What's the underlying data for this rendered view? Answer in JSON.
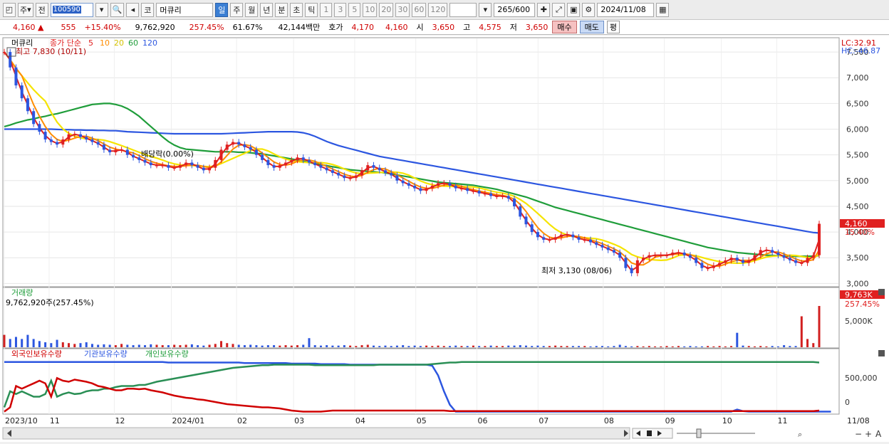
{
  "toolbar": {
    "market_label": "주",
    "prev_label": "전",
    "stock_code": "100590",
    "chart_kind": "코",
    "stock_name": "머큐리",
    "periods": [
      "일",
      "주",
      "월",
      "년",
      "분",
      "초",
      "틱"
    ],
    "active_period": "일",
    "intervals": [
      "1",
      "3",
      "5",
      "10",
      "20",
      "30",
      "60",
      "120"
    ],
    "range_value": "265",
    "range_total": "/600",
    "date_value": "2024/11/08"
  },
  "quote": {
    "price": "4,160",
    "arrow": "▲",
    "change": "555",
    "change_pct": "+15.40%",
    "volume": "9,762,920",
    "volume_ratio": "257.45%",
    "turnover_ratio": "61.67%",
    "amount": "42,144백만",
    "bid_label": "호가",
    "bid1": "4,170",
    "bid2": "4,160",
    "open_label": "시",
    "open": "3,650",
    "high_label": "고",
    "high": "4,575",
    "low_label": "저",
    "low": "3,650",
    "buy_label": "매수",
    "sell_label": "매도",
    "avg_label": "평"
  },
  "price_pane": {
    "legend_name": "머큐리",
    "ma_label": "종가 단순",
    "ma_periods": [
      "5",
      "10",
      "20",
      "60",
      "120"
    ],
    "max_label": "최고 7,830 (10/11)",
    "min_label": "최저 3,130 (08/06)",
    "dividend_label": "배당락(0.00%)",
    "lc_label": "LC:32.91",
    "hc_label": "HC:-46.87",
    "current_price_tag": "4,160",
    "current_pct_tag": "15.40%",
    "y_ticks": [
      "7,500",
      "7,000",
      "6,500",
      "6,000",
      "5,500",
      "5,000",
      "4,500",
      "4,000",
      "3,500",
      "3,000"
    ]
  },
  "volume_pane": {
    "title": "거래량",
    "value_label": "9,762,920주(257.45%)",
    "tag_value": "9,763K",
    "tag_pct": "257.45%",
    "y_tick": "5,000K"
  },
  "holding_pane": {
    "series": [
      "외국인보유수량",
      "기관보유수량",
      "개인보유수량"
    ],
    "y_ticks": [
      "500,000",
      "0"
    ]
  },
  "x_axis": {
    "labels": [
      "2023/10",
      "11",
      "12",
      "2024/01",
      "02",
      "03",
      "04",
      "05",
      "06",
      "07",
      "08",
      "09",
      "10",
      "11",
      "11/08"
    ]
  },
  "chart_data": {
    "type": "line",
    "ylim": [
      2950,
      7750
    ],
    "close": [
      7500,
      7200,
      6850,
      6600,
      6350,
      6100,
      5950,
      5800,
      5750,
      5700,
      5800,
      5900,
      5900,
      5850,
      5800,
      5750,
      5700,
      5600,
      5550,
      5600,
      5600,
      5500,
      5450,
      5400,
      5350,
      5300,
      5300,
      5300,
      5250,
      5250,
      5300,
      5350,
      5300,
      5250,
      5200,
      5250,
      5400,
      5600,
      5700,
      5750,
      5700,
      5650,
      5600,
      5500,
      5400,
      5300,
      5250,
      5300,
      5350,
      5400,
      5450,
      5400,
      5350,
      5300,
      5250,
      5200,
      5150,
      5100,
      5050,
      5050,
      5100,
      5200,
      5300,
      5250,
      5200,
      5150,
      5100,
      5000,
      4950,
      4900,
      4850,
      4800,
      4850,
      4900,
      4950,
      4950,
      4900,
      4850,
      4850,
      4800,
      4800,
      4750,
      4750,
      4700,
      4700,
      4700,
      4650,
      4500,
      4300,
      4150,
      4000,
      3900,
      3850,
      3850,
      3900,
      3950,
      3950,
      3900,
      3850,
      3850,
      3800,
      3750,
      3700,
      3650,
      3600,
      3500,
      3300,
      3200,
      3450,
      3500,
      3550,
      3550,
      3550,
      3550,
      3600,
      3600,
      3550,
      3500,
      3400,
      3300,
      3300,
      3350,
      3400,
      3450,
      3500,
      3450,
      3400,
      3450,
      3550,
      3650,
      3650,
      3600,
      3550,
      3500,
      3450,
      3400,
      3400,
      3500,
      3550,
      4160
    ],
    "ma_colors": {
      "ma5": "#e02020",
      "ma10": "#ff8c00",
      "ma20": "#f5e400",
      "ma60": "#1f9d3a",
      "ma120": "#2c56e0"
    },
    "ma60": [
      6050,
      6080,
      6120,
      6150,
      6180,
      6200,
      6230,
      6250,
      6280,
      6300,
      6330,
      6360,
      6390,
      6420,
      6450,
      6480,
      6490,
      6500,
      6500,
      6480,
      6450,
      6400,
      6330,
      6250,
      6150,
      6050,
      5950,
      5850,
      5760,
      5690,
      5640,
      5610,
      5600,
      5590,
      5580,
      5570,
      5560,
      5560,
      5560,
      5560,
      5550,
      5550,
      5540,
      5530,
      5520,
      5500,
      5480,
      5460,
      5440,
      5420,
      5400,
      5380,
      5350,
      5330,
      5310,
      5290,
      5270,
      5250,
      5230,
      5210,
      5200,
      5190,
      5180,
      5170,
      5160,
      5150,
      5130,
      5110,
      5090,
      5070,
      5050,
      5030,
      5010,
      4990,
      4970,
      4960,
      4950,
      4940,
      4930,
      4920,
      4910,
      4890,
      4870,
      4850,
      4830,
      4800,
      4770,
      4740,
      4710,
      4680,
      4640,
      4600,
      4560,
      4520,
      4480,
      4450,
      4420,
      4390,
      4360,
      4330,
      4300,
      4270,
      4240,
      4210,
      4180,
      4150,
      4120,
      4090,
      4060,
      4030,
      4000,
      3970,
      3940,
      3910,
      3880,
      3850,
      3820,
      3790,
      3760,
      3730,
      3700,
      3680,
      3660,
      3640,
      3620,
      3600,
      3590,
      3580,
      3570,
      3560,
      3550,
      3545,
      3540,
      3535,
      3530,
      3530,
      3530,
      3530,
      3530,
      3540
    ],
    "ma120": [
      6000,
      6000,
      6000,
      6000,
      6000,
      6000,
      6000,
      6000,
      6000,
      5995,
      5990,
      5990,
      5985,
      5985,
      5980,
      5980,
      5975,
      5975,
      5970,
      5970,
      5960,
      5950,
      5945,
      5940,
      5935,
      5930,
      5925,
      5920,
      5915,
      5910,
      5910,
      5910,
      5910,
      5910,
      5910,
      5910,
      5910,
      5910,
      5915,
      5920,
      5925,
      5930,
      5935,
      5940,
      5945,
      5950,
      5950,
      5950,
      5950,
      5950,
      5945,
      5930,
      5900,
      5860,
      5810,
      5760,
      5720,
      5680,
      5650,
      5620,
      5590,
      5560,
      5530,
      5500,
      5470,
      5450,
      5430,
      5410,
      5390,
      5370,
      5350,
      5330,
      5310,
      5290,
      5270,
      5250,
      5230,
      5210,
      5190,
      5170,
      5150,
      5130,
      5110,
      5090,
      5070,
      5050,
      5030,
      5010,
      4990,
      4970,
      4950,
      4930,
      4910,
      4890,
      4870,
      4850,
      4830,
      4810,
      4790,
      4770,
      4750,
      4730,
      4710,
      4690,
      4670,
      4650,
      4630,
      4610,
      4590,
      4570,
      4550,
      4530,
      4510,
      4490,
      4470,
      4450,
      4430,
      4410,
      4390,
      4370,
      4350,
      4330,
      4310,
      4290,
      4270,
      4250,
      4230,
      4210,
      4190,
      4170,
      4150,
      4130,
      4110,
      4090,
      4070,
      4050,
      4030,
      4010,
      3990,
      3980
    ],
    "volume": [
      0.3,
      0.2,
      0.25,
      0.2,
      0.3,
      0.2,
      0.15,
      0.12,
      0.1,
      0.18,
      0.12,
      0.1,
      0.08,
      0.1,
      0.12,
      0.08,
      0.06,
      0.07,
      0.06,
      0.05,
      0.08,
      0.06,
      0.05,
      0.06,
      0.05,
      0.07,
      0.06,
      0.05,
      0.05,
      0.06,
      0.05,
      0.06,
      0.07,
      0.05,
      0.04,
      0.06,
      0.08,
      0.15,
      0.1,
      0.08,
      0.06,
      0.05,
      0.06,
      0.05,
      0.04,
      0.05,
      0.05,
      0.04,
      0.05,
      0.04,
      0.05,
      0.06,
      0.22,
      0.05,
      0.04,
      0.05,
      0.04,
      0.04,
      0.05,
      0.04,
      0.03,
      0.05,
      0.06,
      0.04,
      0.03,
      0.04,
      0.03,
      0.04,
      0.05,
      0.03,
      0.04,
      0.03,
      0.04,
      0.03,
      0.04,
      0.03,
      0.03,
      0.04,
      0.03,
      0.03,
      0.04,
      0.03,
      0.03,
      0.04,
      0.03,
      0.03,
      0.04,
      0.04,
      0.05,
      0.04,
      0.03,
      0.04,
      0.03,
      0.03,
      0.04,
      0.03,
      0.03,
      0.03,
      0.03,
      0.03,
      0.02,
      0.03,
      0.03,
      0.02,
      0.03,
      0.06,
      0.03,
      0.02,
      0.03,
      0.02,
      0.03,
      0.02,
      0.02,
      0.03,
      0.02,
      0.03,
      0.02,
      0.03,
      0.02,
      0.02,
      0.03,
      0.02,
      0.03,
      0.02,
      0.03,
      0.35,
      0.04,
      0.03,
      0.02,
      0.03,
      0.02,
      0.03,
      0.02,
      0.05,
      0.03,
      0.03,
      0.75,
      0.2,
      0.1,
      1.0
    ],
    "holding_foreign": [
      0.02,
      0.1,
      0.5,
      0.45,
      0.5,
      0.55,
      0.6,
      0.55,
      0.3,
      0.65,
      0.6,
      0.58,
      0.62,
      0.6,
      0.58,
      0.55,
      0.5,
      0.48,
      0.45,
      0.42,
      0.42,
      0.45,
      0.45,
      0.44,
      0.45,
      0.42,
      0.4,
      0.38,
      0.35,
      0.32,
      0.3,
      0.28,
      0.27,
      0.25,
      0.24,
      0.22,
      0.2,
      0.18,
      0.16,
      0.15,
      0.14,
      0.13,
      0.12,
      0.11,
      0.1,
      0.1,
      0.09,
      0.08,
      0.06,
      0.04,
      0.03,
      0.02,
      0.02,
      0.02,
      0.02,
      0.03,
      0.04,
      0.04,
      0.04,
      0.04,
      0.04,
      0.04,
      0.04,
      0.04,
      0.04,
      0.04,
      0.04,
      0.04,
      0.04,
      0.04,
      0.04,
      0.04,
      0.04,
      0.04,
      0.04,
      0.04,
      0.03,
      0.03,
      0.03,
      0.03,
      0.03,
      0.03,
      0.03,
      0.03,
      0.03,
      0.03,
      0.03,
      0.03,
      0.03,
      0.03,
      0.03,
      0.03,
      0.03,
      0.03,
      0.03,
      0.03,
      0.03,
      0.03,
      0.03,
      0.03,
      0.03,
      0.03,
      0.03,
      0.03,
      0.03,
      0.03,
      0.03,
      0.03,
      0.03,
      0.03,
      0.03,
      0.03,
      0.03,
      0.03,
      0.03,
      0.03,
      0.03,
      0.03,
      0.03,
      0.03,
      0.03,
      0.03,
      0.03,
      0.03,
      0.03,
      0.03,
      0.03,
      0.03,
      0.03,
      0.03,
      0.03,
      0.03,
      0.03,
      0.03,
      0.03,
      0.03,
      0.03,
      0.03,
      0.03,
      0.04
    ],
    "holding_inst": [
      0.95,
      0.95,
      0.95,
      0.95,
      0.95,
      0.95,
      0.95,
      0.95,
      0.95,
      0.95,
      0.95,
      0.95,
      0.95,
      0.95,
      0.95,
      0.95,
      0.95,
      0.95,
      0.95,
      0.95,
      0.95,
      0.95,
      0.95,
      0.95,
      0.95,
      0.95,
      0.95,
      0.95,
      0.94,
      0.94,
      0.94,
      0.94,
      0.94,
      0.94,
      0.94,
      0.94,
      0.94,
      0.94,
      0.94,
      0.94,
      0.94,
      0.93,
      0.93,
      0.93,
      0.93,
      0.93,
      0.93,
      0.93,
      0.93,
      0.92,
      0.92,
      0.92,
      0.92,
      0.92,
      0.91,
      0.91,
      0.91,
      0.91,
      0.91,
      0.9,
      0.9,
      0.9,
      0.9,
      0.9,
      0.9,
      0.9,
      0.9,
      0.9,
      0.9,
      0.9,
      0.9,
      0.9,
      0.9,
      0.88,
      0.7,
      0.4,
      0.15,
      0.02,
      0.02,
      0.02,
      0.02,
      0.02,
      0.02,
      0.02,
      0.02,
      0.02,
      0.02,
      0.02,
      0.02,
      0.02,
      0.02,
      0.02,
      0.02,
      0.02,
      0.02,
      0.02,
      0.02,
      0.02,
      0.02,
      0.02,
      0.02,
      0.02,
      0.02,
      0.02,
      0.02,
      0.02,
      0.02,
      0.02,
      0.02,
      0.02,
      0.02,
      0.02,
      0.02,
      0.02,
      0.02,
      0.02,
      0.02,
      0.02,
      0.02,
      0.02,
      0.02,
      0.02,
      0.02,
      0.02,
      0.02,
      0.06,
      0.03,
      0.02,
      0.02,
      0.02,
      0.02,
      0.02,
      0.02,
      0.02,
      0.02,
      0.02,
      0.02,
      0.02,
      0.02,
      0.02,
      0.02,
      0.02
    ],
    "holding_indiv": [
      0.1,
      0.4,
      0.35,
      0.4,
      0.35,
      0.3,
      0.3,
      0.35,
      0.6,
      0.3,
      0.35,
      0.38,
      0.35,
      0.36,
      0.4,
      0.42,
      0.42,
      0.45,
      0.45,
      0.48,
      0.5,
      0.5,
      0.5,
      0.52,
      0.52,
      0.55,
      0.58,
      0.6,
      0.62,
      0.64,
      0.66,
      0.68,
      0.7,
      0.72,
      0.74,
      0.76,
      0.78,
      0.8,
      0.82,
      0.84,
      0.85,
      0.86,
      0.87,
      0.88,
      0.89,
      0.89,
      0.9,
      0.9,
      0.9,
      0.9,
      0.9,
      0.9,
      0.9,
      0.89,
      0.89,
      0.89,
      0.89,
      0.89,
      0.89,
      0.89,
      0.89,
      0.89,
      0.89,
      0.89,
      0.9,
      0.9,
      0.9,
      0.9,
      0.9,
      0.9,
      0.9,
      0.9,
      0.9,
      0.91,
      0.92,
      0.93,
      0.94,
      0.94,
      0.95,
      0.95,
      0.95,
      0.95,
      0.95,
      0.95,
      0.95,
      0.95,
      0.95,
      0.95,
      0.95,
      0.95,
      0.95,
      0.95,
      0.95,
      0.95,
      0.95,
      0.95,
      0.95,
      0.95,
      0.95,
      0.95,
      0.95,
      0.95,
      0.95,
      0.95,
      0.95,
      0.95,
      0.95,
      0.95,
      0.95,
      0.95,
      0.95,
      0.95,
      0.95,
      0.95,
      0.95,
      0.95,
      0.95,
      0.95,
      0.95,
      0.95,
      0.95,
      0.95,
      0.95,
      0.95,
      0.95,
      0.95,
      0.95,
      0.95,
      0.95,
      0.95,
      0.95,
      0.95,
      0.95,
      0.95,
      0.95,
      0.95,
      0.95,
      0.95,
      0.95,
      0.94
    ]
  }
}
